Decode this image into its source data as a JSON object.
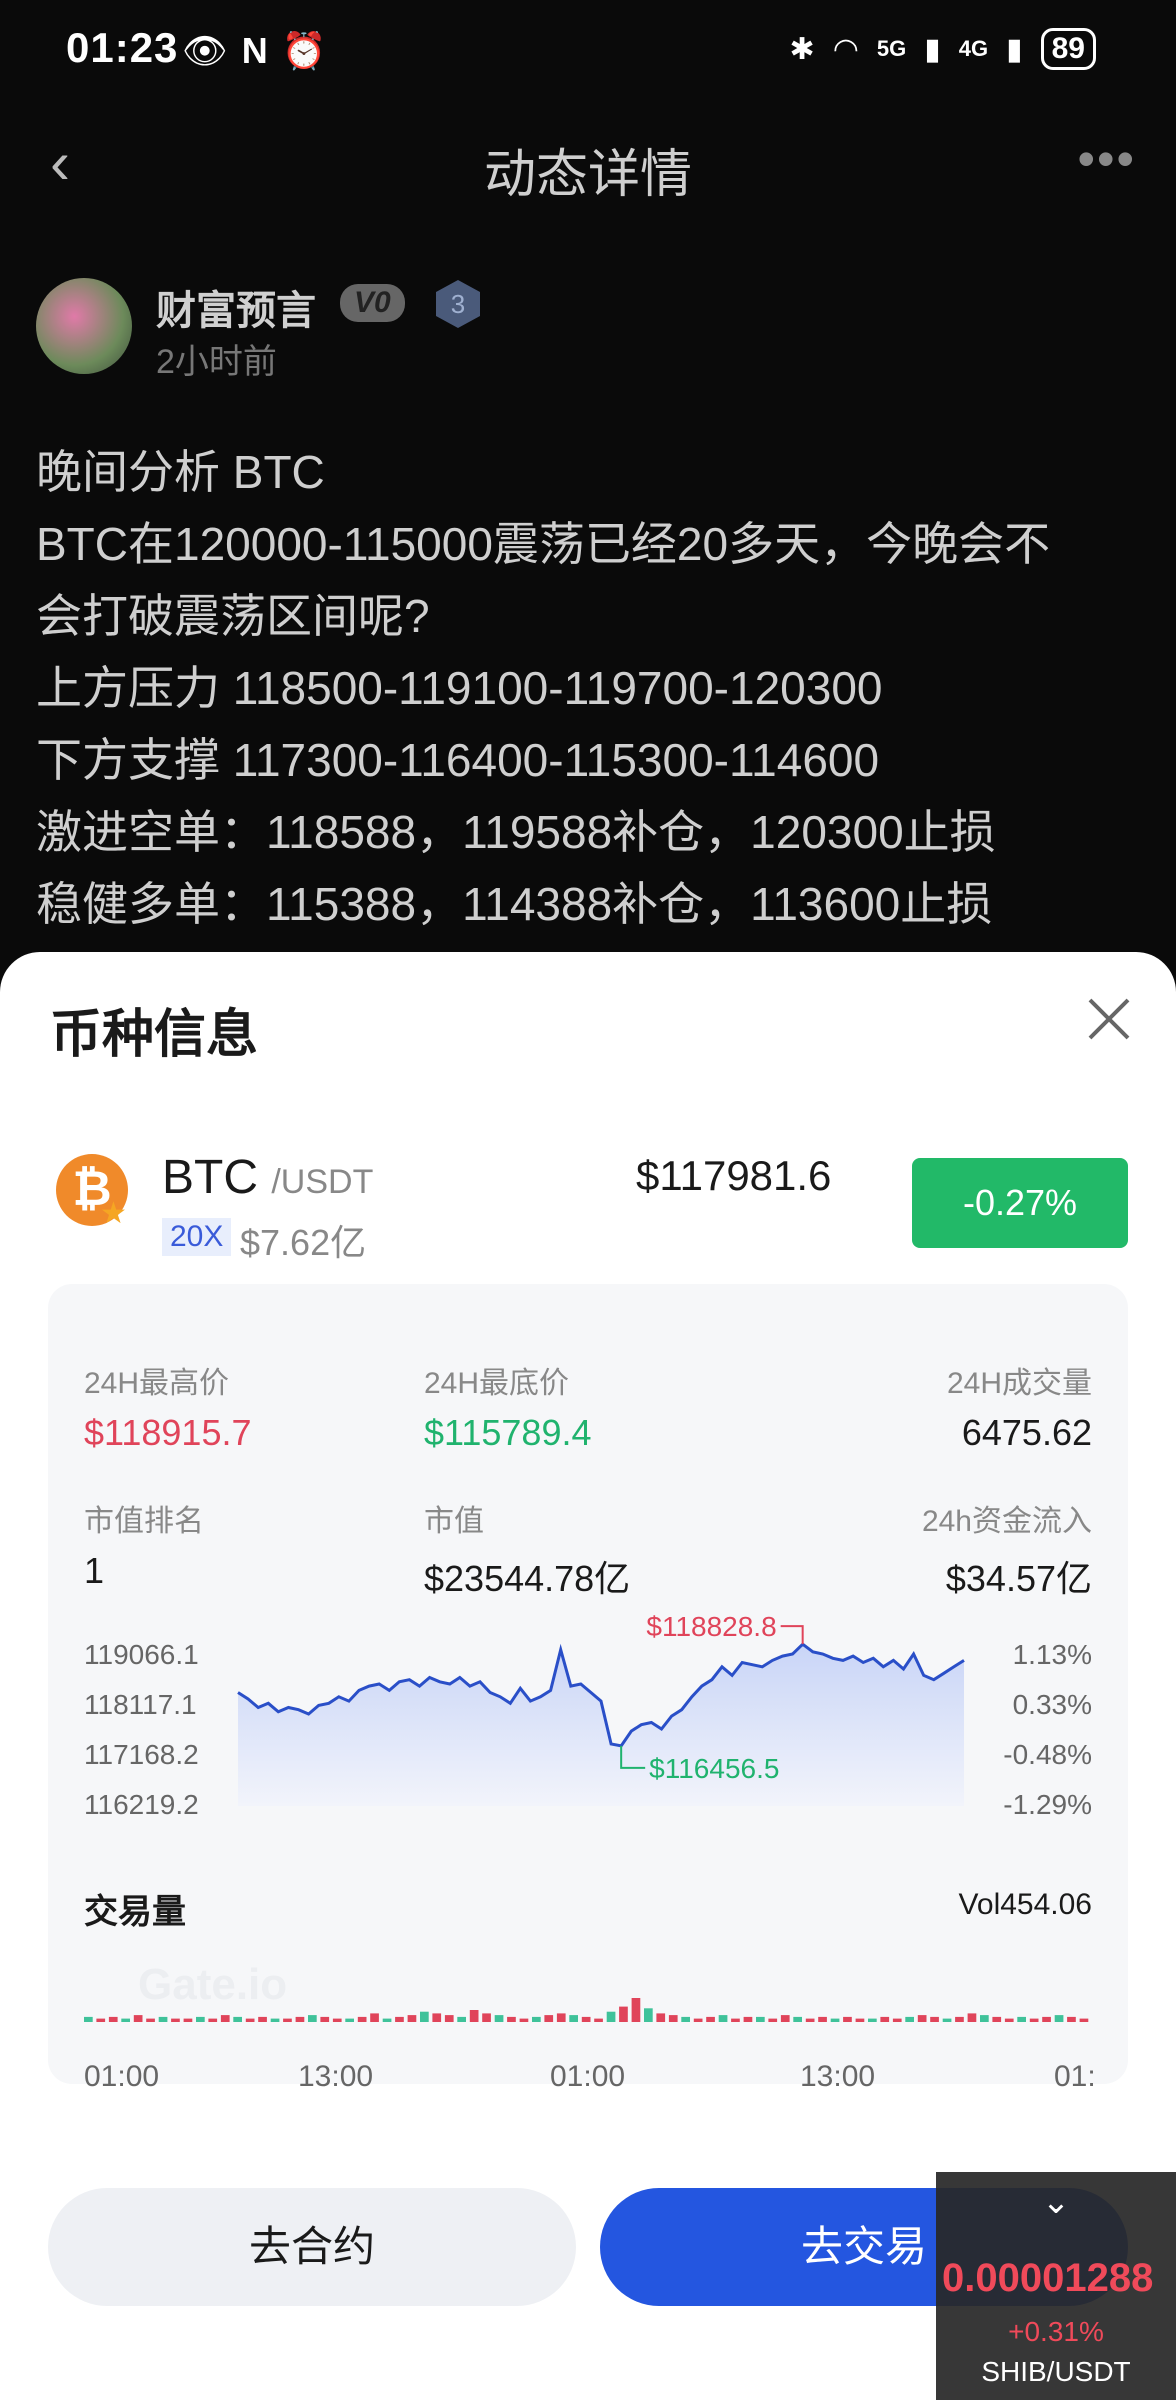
{
  "status_bar": {
    "time": "01:23",
    "net1": "5G",
    "net2": "4G",
    "battery": "89"
  },
  "header": {
    "title": "动态详情"
  },
  "author": {
    "name": "财富预言",
    "vip": "V0",
    "level": "3",
    "time_ago": "2小时前"
  },
  "post_lines": [
    "晚间分析 BTC",
    "BTC在120000-115000震荡已经20多天，今晚会不",
    "会打破震荡区间呢?",
    "上方压力 118500-119100-119700-120300",
    "下方支撑 117300-116400-115300-114600",
    "激进空单：118588，119588补仓，120300止损",
    "稳健多单：115388，114388补仓，113600止损"
  ],
  "sheet": {
    "title": "币种信息",
    "symbol": "BTC",
    "quote": "/USDT",
    "leverage": "20X",
    "market_cap_short": "$7.62亿",
    "price": "$117981.6",
    "change": "-0.27%",
    "stats": {
      "high_label": "24H最高价",
      "high": "$118915.7",
      "low_label": "24H最底价",
      "low": "$115789.4",
      "volume_label": "24H成交量",
      "volume": "6475.62",
      "rank_label": "市值排名",
      "rank": "1",
      "mcap_label": "市值",
      "mcap": "$23544.78亿",
      "inflow_label": "24h资金流入",
      "inflow": "$34.57亿"
    },
    "volume_title": "交易量",
    "volume_value": "Vol454.06",
    "watermark": "Gate.io",
    "btn_contract": "去合约",
    "btn_trade": "去交易"
  },
  "chart_data": {
    "type": "line",
    "y_ticks": [
      "119066.1",
      "118117.1",
      "117168.2",
      "116219.2"
    ],
    "pct_ticks": [
      "1.13%",
      "0.33%",
      "-0.48%",
      "-1.29%"
    ],
    "x_ticks": [
      "01:00",
      "13:00",
      "01:00",
      "13:00",
      "01:"
    ],
    "max_label": "$118828.8",
    "min_label": "$116456.5",
    "ylim": [
      116219.2,
      119066.1
    ],
    "values": [
      117700,
      117550,
      117350,
      117450,
      117250,
      117350,
      117300,
      117200,
      117400,
      117450,
      117600,
      117500,
      117750,
      117850,
      117900,
      117750,
      117950,
      118000,
      117850,
      118050,
      117950,
      117900,
      118050,
      117850,
      117950,
      117700,
      117600,
      117450,
      117800,
      117500,
      117600,
      117750,
      118700,
      117850,
      117900,
      117700,
      117500,
      116500,
      116456.5,
      116800,
      116950,
      117000,
      116850,
      117150,
      117300,
      117600,
      117850,
      118000,
      118300,
      118100,
      118400,
      118350,
      118300,
      118450,
      118550,
      118600,
      118828.8,
      118650,
      118600,
      118500,
      118450,
      118550,
      118400,
      118500,
      118300,
      118450,
      118250,
      118600,
      118100,
      118000,
      118150,
      118300,
      118450
    ]
  },
  "volume_bars": [
    3,
    2,
    3,
    2,
    4,
    2,
    3,
    2,
    2,
    3,
    2,
    4,
    3,
    2,
    3,
    2,
    2,
    3,
    4,
    3,
    2,
    2,
    3,
    5,
    2,
    3,
    4,
    6,
    5,
    4,
    3,
    7,
    5,
    4,
    3,
    2,
    3,
    4,
    5,
    4,
    3,
    2,
    6,
    9,
    14,
    8,
    5,
    4,
    3,
    2,
    3,
    4,
    2,
    3,
    3,
    2,
    4,
    3,
    2,
    3,
    2,
    3,
    2,
    2,
    3,
    2,
    3,
    4,
    3,
    2,
    3,
    5,
    4,
    3,
    2,
    3,
    2,
    3,
    4,
    3,
    2
  ],
  "floating_ticker": {
    "price": "0.00001288",
    "change": "+0.31%",
    "pair": "SHIB/USDT"
  }
}
